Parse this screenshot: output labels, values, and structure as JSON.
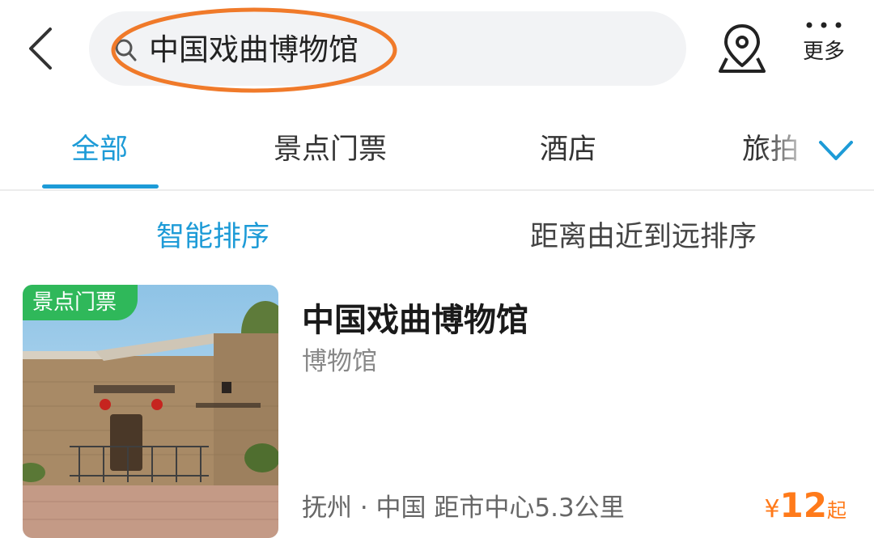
{
  "header": {
    "search_query": "中国戏曲博物馆",
    "more_label": "更多",
    "icons": {
      "back": "chevron-left-icon",
      "search": "search-icon",
      "map": "map-pin-icon",
      "more": "more-dots-icon"
    },
    "annotation_color": "#f07a2a"
  },
  "tabs": {
    "items": [
      {
        "label": "全部",
        "active": true
      },
      {
        "label": "景点门票",
        "active": false
      },
      {
        "label": "酒店",
        "active": false
      },
      {
        "label": "旅拍",
        "active": false
      }
    ],
    "expand_icon": "chevron-down-icon",
    "accent_color": "#1d9bd7"
  },
  "sort": {
    "options": [
      {
        "label": "智能排序",
        "active": true
      },
      {
        "label": "距离由近到远排序",
        "active": false
      }
    ]
  },
  "results": [
    {
      "badge": "景点门票",
      "title": "中国戏曲博物馆",
      "category": "博物馆",
      "location": "抚州 · 中国  距市中心5.3公里",
      "price": {
        "currency": "¥",
        "value": "12",
        "suffix": "起"
      },
      "badge_color": "#2fb85a",
      "price_color": "#ff7a1a"
    }
  ]
}
